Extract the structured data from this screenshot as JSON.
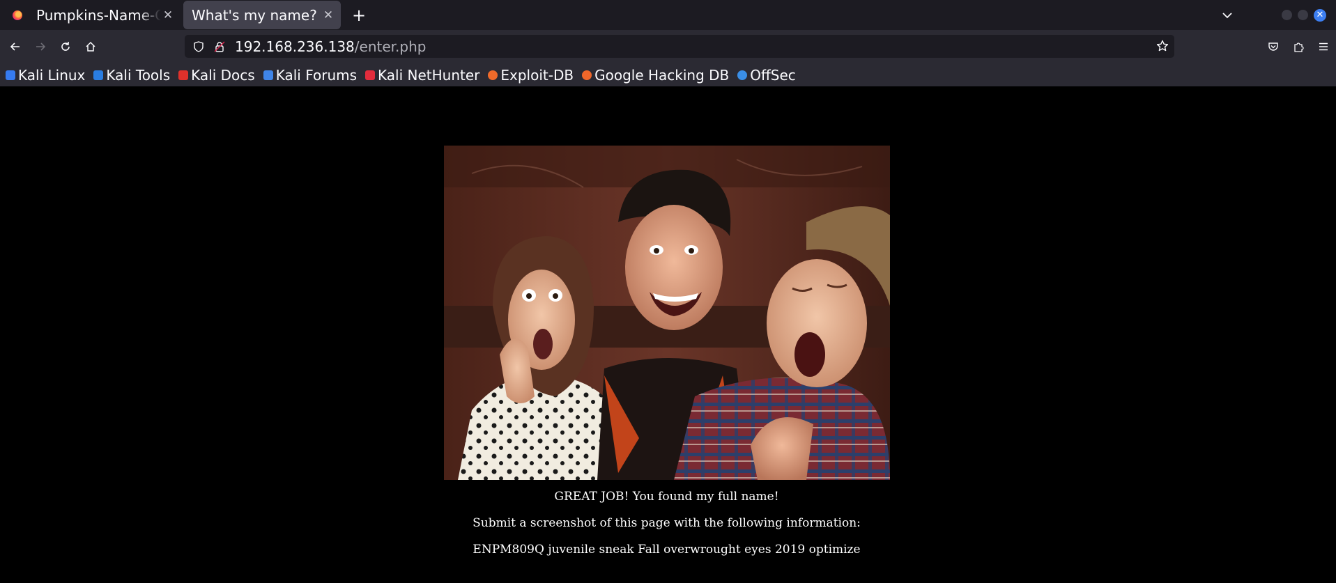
{
  "tabs": [
    {
      "title": "Pumpkins-Name-Challenge",
      "active": false
    },
    {
      "title": "What's my name?",
      "active": true
    }
  ],
  "url": {
    "host": "192.168.236.138",
    "path": "/enter.php"
  },
  "bookmarks": [
    {
      "label": "Kali Linux",
      "color": "#367bf0"
    },
    {
      "label": "Kali Tools",
      "color": "#2a7de1"
    },
    {
      "label": "Kali Docs",
      "color": "#e0312b"
    },
    {
      "label": "Kali Forums",
      "color": "#3f85e8"
    },
    {
      "label": "Kali NetHunter",
      "color": "#e22c3c"
    },
    {
      "label": "Exploit-DB",
      "color": "#f06a2a"
    },
    {
      "label": "Google Hacking DB",
      "color": "#f0672a"
    },
    {
      "label": "OffSec",
      "color": "#3a8ee6"
    }
  ],
  "page": {
    "line1": "GREAT JOB! You found my full name!",
    "line2": "Submit a screenshot of this page with the following information:",
    "line3": "ENPM809Q juvenile sneak Fall overwrought eyes 2019 optimize"
  }
}
